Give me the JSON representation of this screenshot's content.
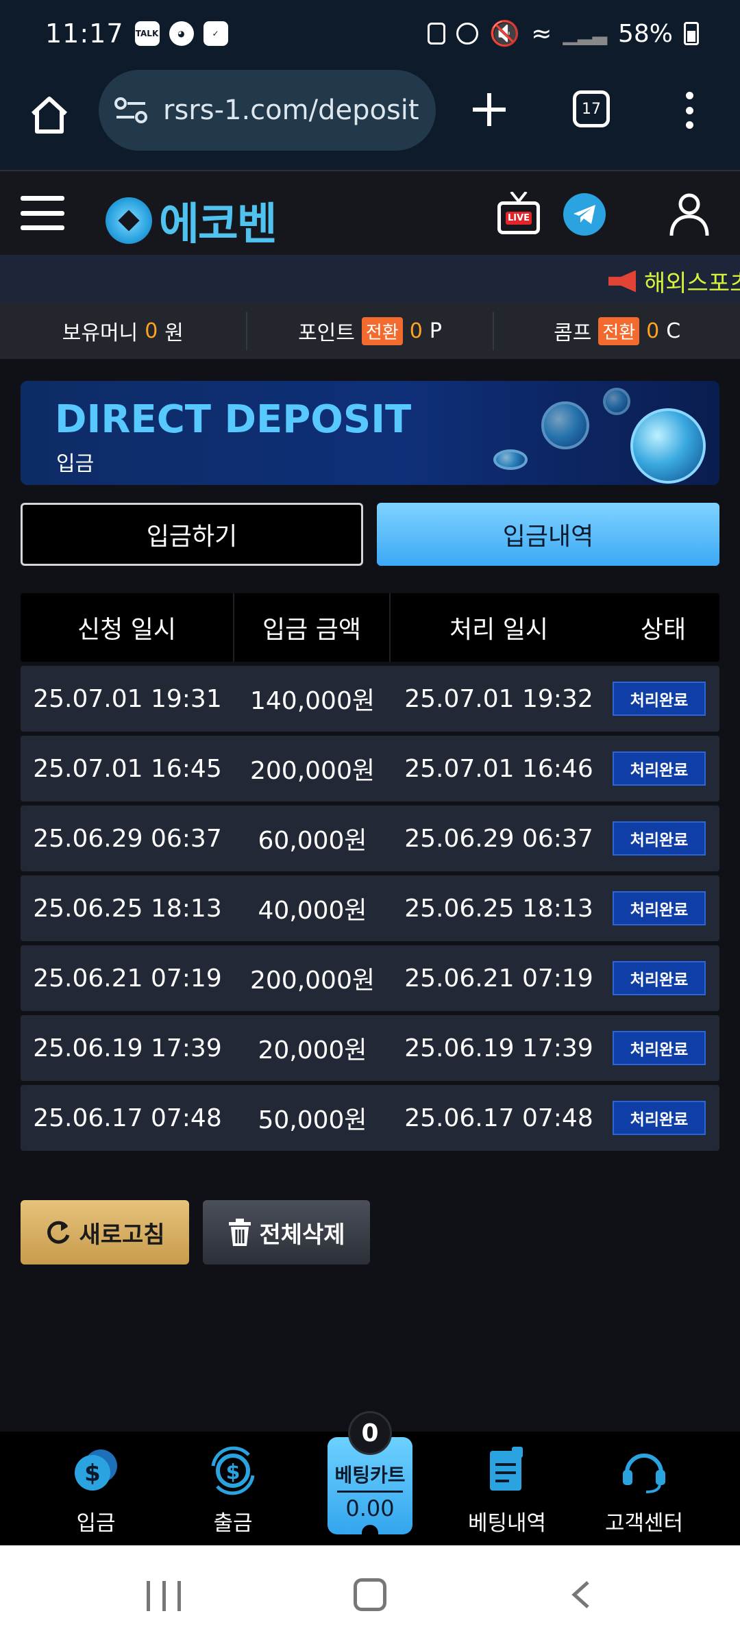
{
  "status_bar": {
    "time": "11:17",
    "left_icons": [
      "talk-icon",
      "noodle-icon",
      "check-icon"
    ],
    "right_icons": [
      "battery-saver-icon",
      "alarm-icon",
      "mute-icon",
      "wifi-icon",
      "signal-icon"
    ],
    "battery": "58%"
  },
  "browser": {
    "url": "rsrs-1.com/deposit",
    "tab_count": "17"
  },
  "header": {
    "logo_text": "에코벤",
    "live_badge": "LIVE"
  },
  "ticker": {
    "text": "해외스포츠"
  },
  "balance": {
    "money_label": "보유머니",
    "money_value": "0",
    "money_unit": "원",
    "point_label": "포인트",
    "point_convert": "전환",
    "point_value": "0",
    "point_unit": "P",
    "comp_label": "콤프",
    "comp_convert": "전환",
    "comp_value": "0",
    "comp_unit": "C"
  },
  "banner": {
    "title": "DIRECT DEPOSIT",
    "subtitle": "입금"
  },
  "tabs": {
    "deposit": "입금하기",
    "history": "입금내역"
  },
  "table": {
    "headers": [
      "신청 일시",
      "입금 금액",
      "처리 일시",
      "상태"
    ],
    "rows": [
      {
        "requested": "25.07.01 19:31",
        "amount": "140,000원",
        "processed": "25.07.01 19:32",
        "status": "처리완료"
      },
      {
        "requested": "25.07.01 16:45",
        "amount": "200,000원",
        "processed": "25.07.01 16:46",
        "status": "처리완료"
      },
      {
        "requested": "25.06.29 06:37",
        "amount": "60,000원",
        "processed": "25.06.29 06:37",
        "status": "처리완료"
      },
      {
        "requested": "25.06.25 18:13",
        "amount": "40,000원",
        "processed": "25.06.25 18:13",
        "status": "처리완료"
      },
      {
        "requested": "25.06.21 07:19",
        "amount": "200,000원",
        "processed": "25.06.21 07:19",
        "status": "처리완료"
      },
      {
        "requested": "25.06.19 17:39",
        "amount": "20,000원",
        "processed": "25.06.19 17:39",
        "status": "처리완료"
      },
      {
        "requested": "25.06.17 07:48",
        "amount": "50,000원",
        "processed": "25.06.17 07:48",
        "status": "처리완료"
      }
    ]
  },
  "actions": {
    "refresh": "새로고침",
    "delete_all": "전체삭제"
  },
  "bottom_nav": {
    "deposit": "입금",
    "withdraw": "출금",
    "bet_cart_label": "베팅카트",
    "bet_cart_amount": "0.00",
    "bet_cart_count": "0",
    "bet_history": "베팅내역",
    "support": "고객센터"
  },
  "colors": {
    "accent_blue": "#3ca9f5",
    "accent_orange": "#ffa21f",
    "badge_blue": "#0f3fa6",
    "refresh_gold": "#c79c4c"
  }
}
